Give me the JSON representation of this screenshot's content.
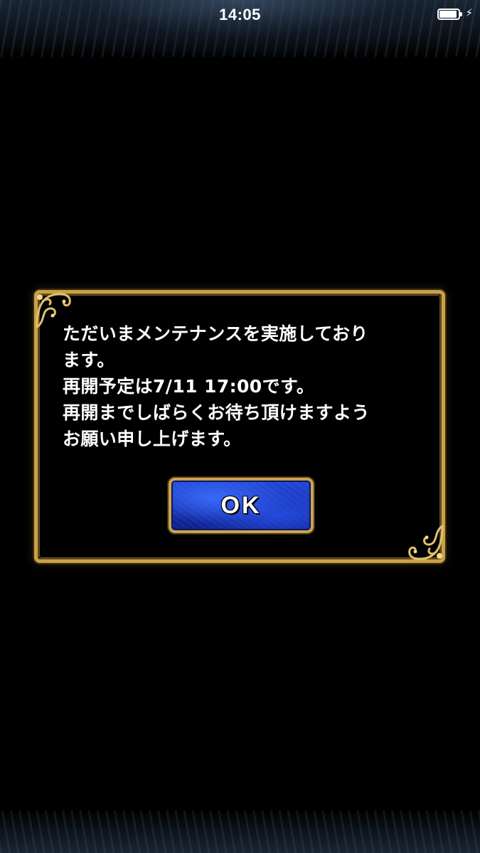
{
  "status_bar": {
    "time": "14:05",
    "battery_icon": "battery-icon",
    "charging_icon": "lightning-icon",
    "charging_glyph": "⚡"
  },
  "dialog": {
    "message_lines": [
      "ただいまメンテナンスを実施しており",
      "ます。",
      "再開予定は7/11 17:00です。",
      "再開までしばらくお待ち頂けますよう",
      "お願い申し上げます。"
    ],
    "ok_label": "OK",
    "ornament_icon": "gold-scroll-ornament-icon"
  },
  "colors": {
    "frame_gold": "#c8a24a",
    "button_blue": "#1530b0",
    "background": "#000000",
    "text": "#ffffff"
  }
}
